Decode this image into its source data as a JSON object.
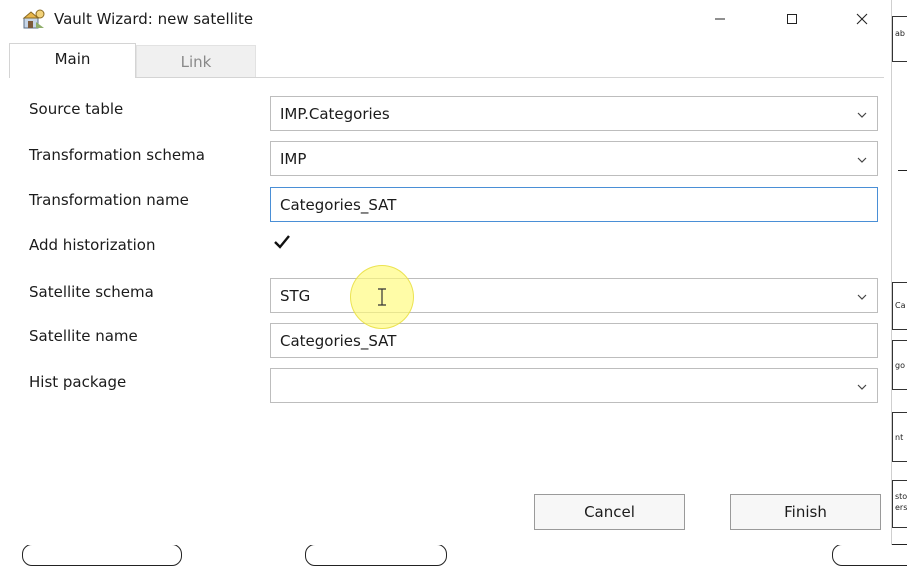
{
  "window": {
    "title": "Vault Wizard: new satellite",
    "controls": {
      "minimize": "minimize-icon",
      "maximize": "maximize-icon",
      "close": "close-icon"
    }
  },
  "tabs": [
    {
      "label": "Main",
      "active": true
    },
    {
      "label": "Link",
      "active": false
    }
  ],
  "form": {
    "source_table": {
      "label": "Source table",
      "value": "IMP.Categories"
    },
    "transformation_schema": {
      "label": "Transformation schema",
      "value": "IMP"
    },
    "transformation_name": {
      "label": "Transformation name",
      "value": "Categories_SAT"
    },
    "add_historization": {
      "label": "Add historization",
      "checked": true
    },
    "satellite_schema": {
      "label": "Satellite schema",
      "value": "STG"
    },
    "satellite_name": {
      "label": "Satellite name",
      "value": "Categories_SAT"
    },
    "hist_package": {
      "label": "Hist package",
      "value": ""
    }
  },
  "buttons": {
    "cancel": "Cancel",
    "finish": "Finish"
  },
  "background": {
    "fragments": [
      "ab",
      "Ca",
      "go",
      "nt",
      "sto",
      "ers"
    ]
  },
  "colors": {
    "focus_border": "#4a8fd6",
    "cursor_highlight": "#fff878"
  }
}
